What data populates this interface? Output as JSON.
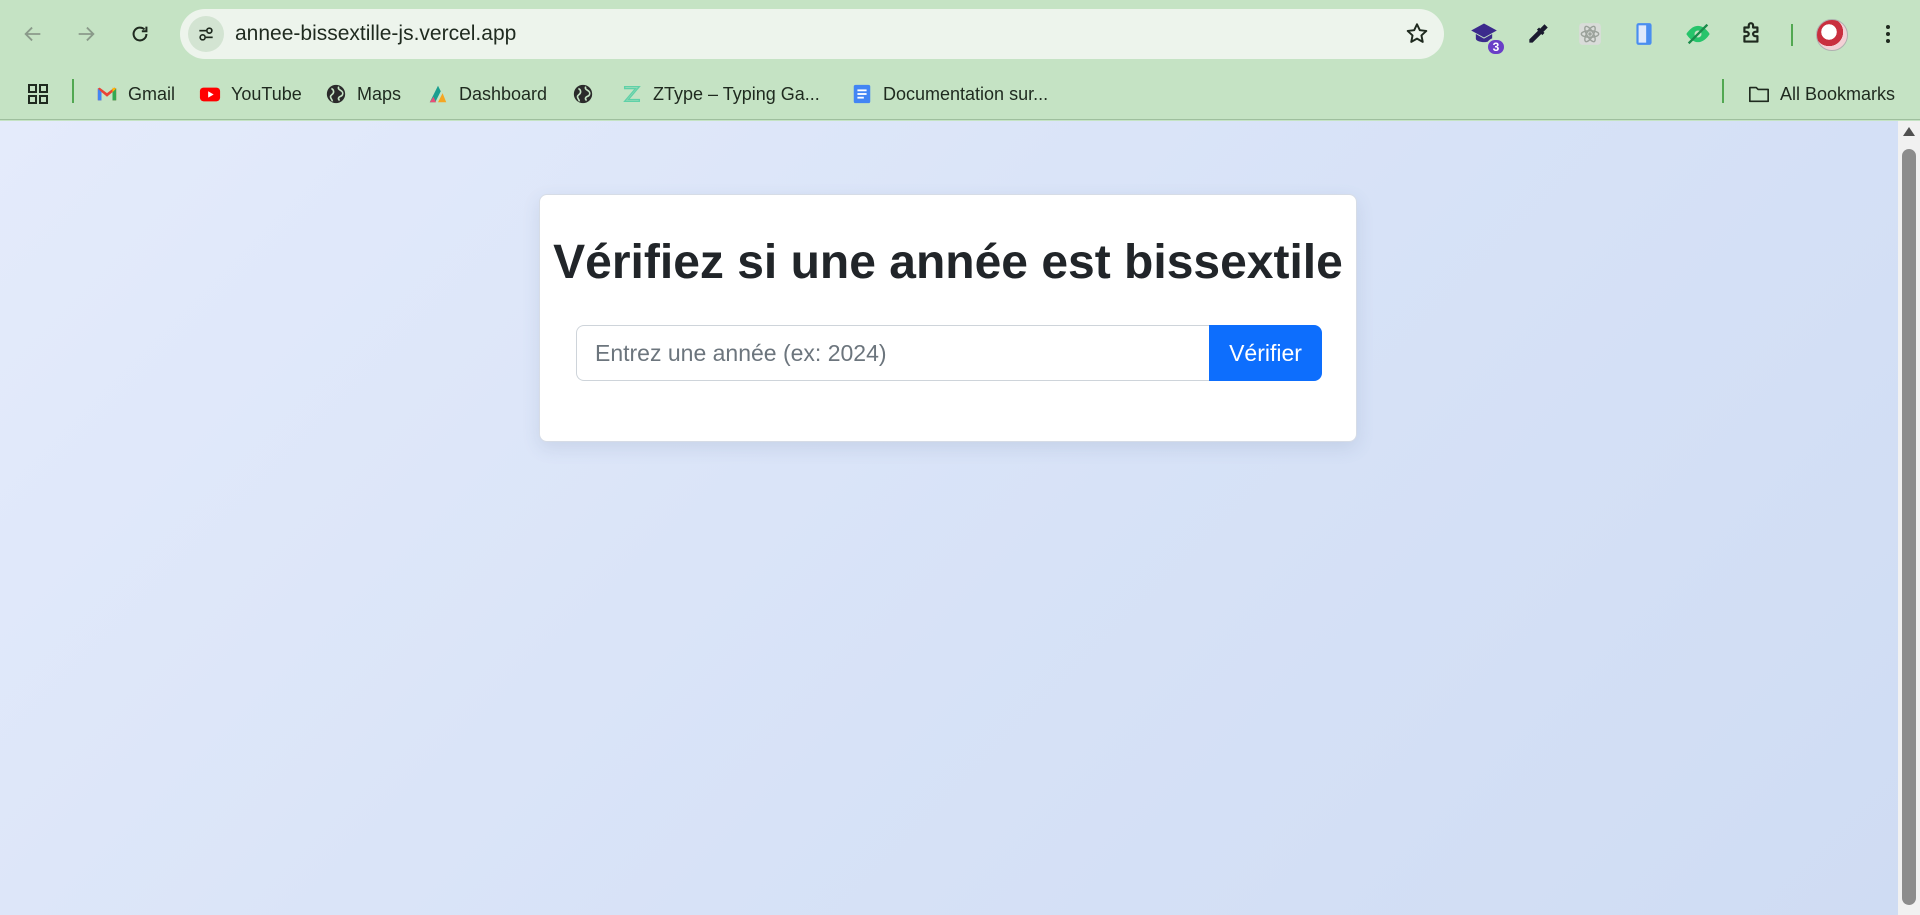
{
  "browser": {
    "url": "annee-bissextille-js.vercel.app",
    "extension_badge": "3"
  },
  "bookmarks": {
    "items": [
      {
        "label": "Gmail",
        "icon": "gmail-icon"
      },
      {
        "label": "YouTube",
        "icon": "youtube-icon"
      },
      {
        "label": "Maps",
        "icon": "globe-icon"
      },
      {
        "label": "Dashboard",
        "icon": "dashboard-icon"
      },
      {
        "label": "",
        "icon": "globe-icon"
      },
      {
        "label": "ZType – Typing Ga...",
        "icon": "ztype-icon"
      },
      {
        "label": "Documentation sur...",
        "icon": "docs-icon"
      }
    ],
    "all_bookmarks": "All Bookmarks"
  },
  "page": {
    "title": "Vérifiez si une année est bissextile",
    "input_placeholder": "Entrez une année (ex: 2024)",
    "input_value": "",
    "button_label": "Vérifier"
  },
  "colors": {
    "chrome_bg": "#c5e3c4",
    "page_bg": "#dbe5f8",
    "button": "#0d6efd",
    "title_text": "#212529"
  }
}
